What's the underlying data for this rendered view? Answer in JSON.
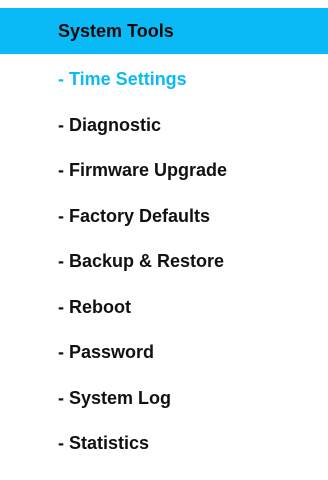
{
  "menu": {
    "header": "System Tools",
    "accent_color": "#0abaf7",
    "items": [
      {
        "label": "- Time Settings",
        "active": true
      },
      {
        "label": "- Diagnostic",
        "active": false
      },
      {
        "label": "- Firmware Upgrade",
        "active": false
      },
      {
        "label": "- Factory Defaults",
        "active": false
      },
      {
        "label": "- Backup & Restore",
        "active": false
      },
      {
        "label": "- Reboot",
        "active": false
      },
      {
        "label": "- Password",
        "active": false
      },
      {
        "label": "- System Log",
        "active": false
      },
      {
        "label": "- Statistics",
        "active": false
      }
    ]
  }
}
